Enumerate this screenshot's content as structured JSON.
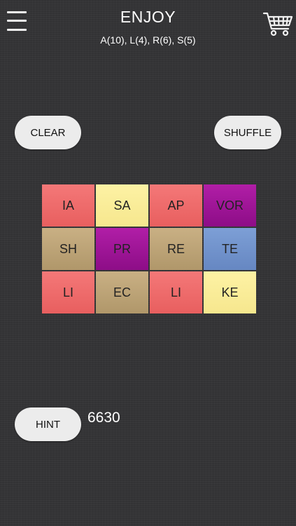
{
  "header": {
    "title": "ENJOY",
    "subtitle": "A(10), L(4), R(6), S(5)"
  },
  "icons": {
    "menu": "hamburger-menu-icon",
    "cart": "shopping-cart-icon"
  },
  "buttons": {
    "clear": "CLEAR",
    "shuffle": "SHUFFLE",
    "hint": "HINT"
  },
  "colors": {
    "red": "#f06b6b",
    "yellow": "#fbef9c",
    "purple": "#9e169a",
    "tan": "#bea47a",
    "blue": "#7294cd",
    "background": "#343436"
  },
  "tiles": [
    {
      "text": "IA",
      "color": "red"
    },
    {
      "text": "SA",
      "color": "yellow"
    },
    {
      "text": "AP",
      "color": "red"
    },
    {
      "text": "VOR",
      "color": "purple"
    },
    {
      "text": "SH",
      "color": "tan"
    },
    {
      "text": "PR",
      "color": "purple"
    },
    {
      "text": "RE",
      "color": "tan"
    },
    {
      "text": "TE",
      "color": "blue"
    },
    {
      "text": "LI",
      "color": "red"
    },
    {
      "text": "EC",
      "color": "tan"
    },
    {
      "text": "LI",
      "color": "red"
    },
    {
      "text": "KE",
      "color": "yellow"
    }
  ],
  "score": "6630"
}
